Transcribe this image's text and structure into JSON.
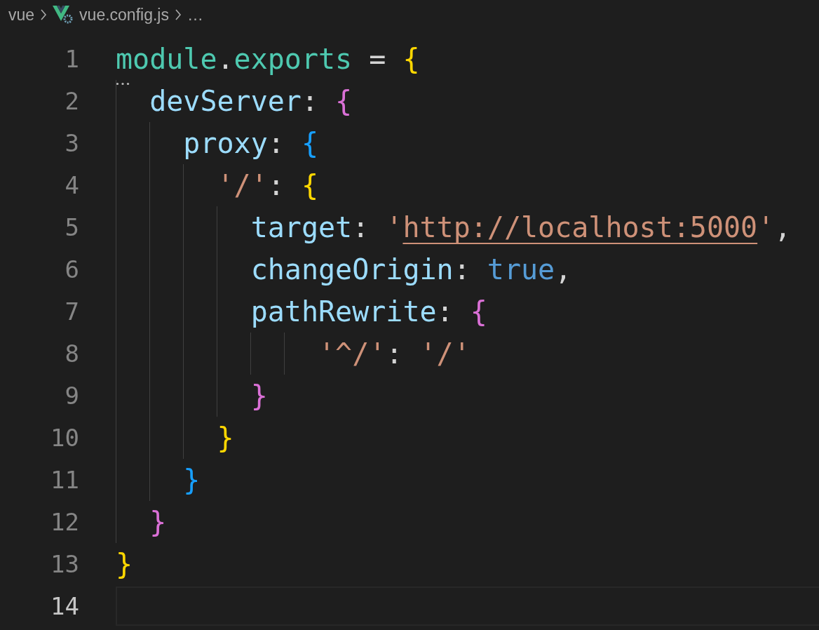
{
  "breadcrumb": [
    {
      "label": "vue",
      "kind": "folder"
    },
    {
      "label": "vue.config.js",
      "kind": "file"
    },
    {
      "label": "…",
      "kind": "more"
    }
  ],
  "lines": [
    {
      "number": "1",
      "current": false,
      "tokens": [
        {
          "text": "module",
          "kind": "variable"
        },
        {
          "text": ".",
          "kind": "punct"
        },
        {
          "text": "exports",
          "kind": "variable"
        },
        {
          "text": " =",
          "kind": "punct"
        },
        {
          "text": " {",
          "kind": "bracket1"
        }
      ]
    },
    {
      "number": "2",
      "current": false,
      "tokens": [
        {
          "text": "  devServer",
          "kind": "property"
        },
        {
          "text": ":",
          "kind": "punct"
        },
        {
          "text": " {",
          "kind": "bracket2"
        }
      ]
    },
    {
      "number": "3",
      "current": false,
      "tokens": [
        {
          "text": "    proxy",
          "kind": "property"
        },
        {
          "text": ":",
          "kind": "punct"
        },
        {
          "text": " {",
          "kind": "bracket3"
        }
      ]
    },
    {
      "number": "4",
      "current": false,
      "tokens": [
        {
          "text": "      '/'",
          "kind": "string"
        },
        {
          "text": ":",
          "kind": "punct"
        },
        {
          "text": " {",
          "kind": "bracket1"
        }
      ]
    },
    {
      "number": "5",
      "current": false,
      "tokens": [
        {
          "text": "        target",
          "kind": "property"
        },
        {
          "text": ":",
          "kind": "punct"
        },
        {
          "text": " '",
          "kind": "string"
        },
        {
          "text": "http://localhost:5000",
          "kind": "link"
        },
        {
          "text": "'",
          "kind": "string"
        },
        {
          "text": ",",
          "kind": "punct"
        }
      ]
    },
    {
      "number": "6",
      "current": false,
      "tokens": [
        {
          "text": "        changeOrigin",
          "kind": "property"
        },
        {
          "text": ":",
          "kind": "punct"
        },
        {
          "text": " true",
          "kind": "keyword"
        },
        {
          "text": ",",
          "kind": "punct"
        }
      ]
    },
    {
      "number": "7",
      "current": false,
      "tokens": [
        {
          "text": "        pathRewrite",
          "kind": "property"
        },
        {
          "text": ":",
          "kind": "punct"
        },
        {
          "text": " {",
          "kind": "bracket2"
        }
      ]
    },
    {
      "number": "8",
      "current": false,
      "tokens": [
        {
          "text": "            '^/'",
          "kind": "string"
        },
        {
          "text": ":",
          "kind": "punct"
        },
        {
          "text": " '/'",
          "kind": "string"
        }
      ]
    },
    {
      "number": "9",
      "current": false,
      "tokens": [
        {
          "text": "        }",
          "kind": "bracket2"
        }
      ]
    },
    {
      "number": "10",
      "current": false,
      "tokens": [
        {
          "text": "      }",
          "kind": "bracket1"
        }
      ]
    },
    {
      "number": "11",
      "current": false,
      "tokens": [
        {
          "text": "    }",
          "kind": "bracket3"
        }
      ]
    },
    {
      "number": "12",
      "current": false,
      "tokens": [
        {
          "text": "  }",
          "kind": "bracket2"
        }
      ]
    },
    {
      "number": "13",
      "current": false,
      "tokens": [
        {
          "text": "}",
          "kind": "bracket1"
        }
      ]
    },
    {
      "number": "14",
      "current": true
    }
  ]
}
